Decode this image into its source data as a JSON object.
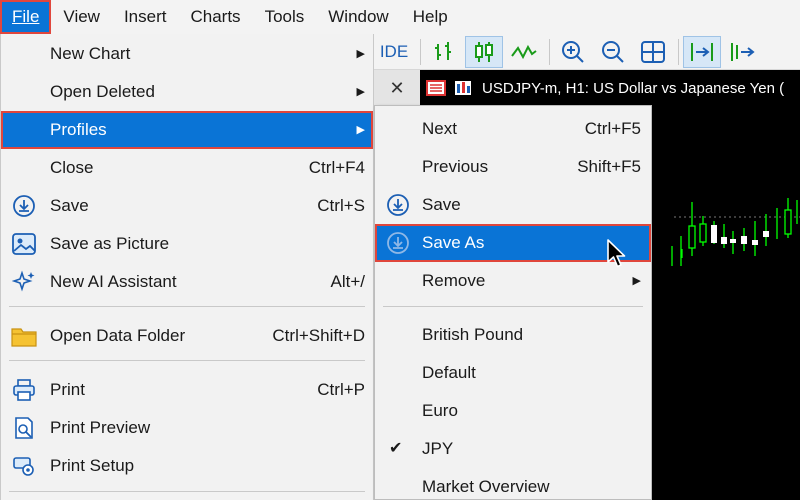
{
  "menubar": {
    "items": [
      {
        "label": "File",
        "accel_index": 0
      },
      {
        "label": "View"
      },
      {
        "label": "Insert"
      },
      {
        "label": "Charts"
      },
      {
        "label": "Tools"
      },
      {
        "label": "Window"
      },
      {
        "label": "Help"
      }
    ]
  },
  "toolbar": {
    "ide_label": "IDE",
    "buttons": [
      "bar-chart-icon",
      "candlestick-icon",
      "line-chart-icon",
      "zoom-in-icon",
      "zoom-out-icon",
      "tile-windows-icon",
      "autoscroll-icon",
      "chart-shift-icon"
    ]
  },
  "chart": {
    "close_label": "✕",
    "tab_title": "USDJPY-m, H1:  US Dollar vs Japanese Yen (",
    "colors": {
      "background": "#000000",
      "bull": "#00ff00",
      "bear": "#ffffff"
    }
  },
  "file_menu": {
    "items": [
      {
        "label": "New Chart",
        "submenu": true
      },
      {
        "label": "Open Deleted",
        "submenu": true
      },
      {
        "label": "Profiles",
        "submenu": true,
        "selected": true
      },
      {
        "label": "Close",
        "shortcut": "Ctrl+F4"
      },
      {
        "label": "Save",
        "shortcut": "Ctrl+S",
        "icon": "save-icon"
      },
      {
        "label": "Save as Picture",
        "icon": "picture-icon"
      },
      {
        "label": "New AI Assistant",
        "shortcut": "Alt+/",
        "icon": "sparkle-icon"
      },
      {
        "label": "Open Data Folder",
        "shortcut": "Ctrl+Shift+D",
        "icon": "folder-icon"
      },
      {
        "label": "Print",
        "shortcut": "Ctrl+P",
        "icon": "printer-icon"
      },
      {
        "label": "Print Preview",
        "icon": "print-preview-icon"
      },
      {
        "label": "Print Setup",
        "icon": "print-setup-icon"
      }
    ]
  },
  "profiles_submenu": {
    "items": [
      {
        "label": "Next",
        "shortcut": "Ctrl+F5"
      },
      {
        "label": "Previous",
        "shortcut": "Shift+F5"
      },
      {
        "label": "Save",
        "icon": "save-icon"
      },
      {
        "label": "Save As",
        "icon": "save-icon",
        "selected": true
      },
      {
        "label": "Remove",
        "submenu": true
      },
      {
        "label": "British Pound"
      },
      {
        "label": "Default"
      },
      {
        "label": "Euro"
      },
      {
        "label": "JPY",
        "checked": true,
        "check_mark": "✔"
      },
      {
        "label": "Market Overview"
      }
    ]
  },
  "accent_color": "#0a74d6",
  "highlight_border": "#e0463c"
}
